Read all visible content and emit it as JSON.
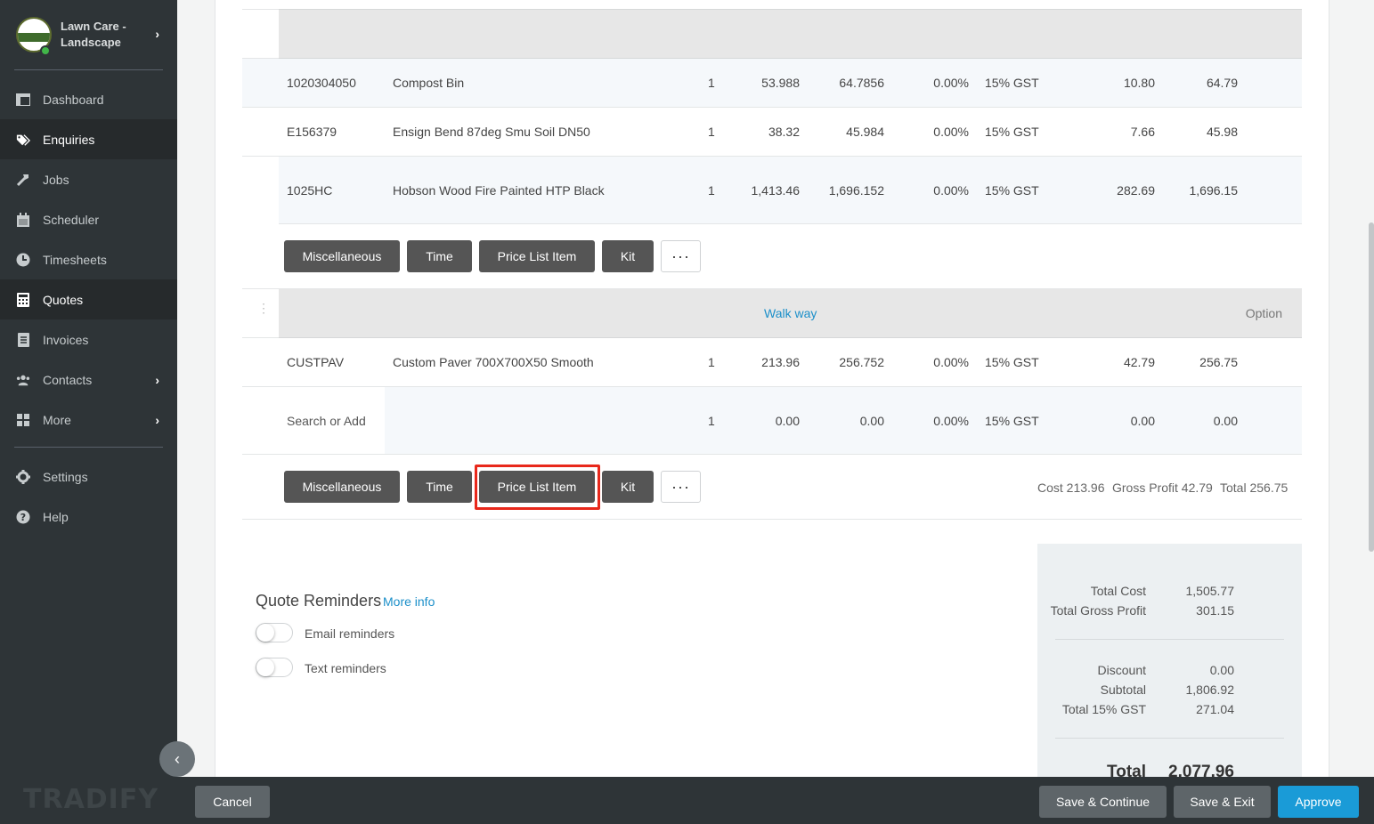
{
  "sidebar": {
    "company": "Lawn Care - Landscape",
    "logo_text": "LAWN CARE",
    "items": [
      {
        "label": "Dashboard",
        "icon": "dashboard-icon"
      },
      {
        "label": "Enquiries",
        "icon": "tags-icon"
      },
      {
        "label": "Jobs",
        "icon": "hammer-icon"
      },
      {
        "label": "Scheduler",
        "icon": "calendar-icon"
      },
      {
        "label": "Timesheets",
        "icon": "clock-icon"
      },
      {
        "label": "Quotes",
        "icon": "calculator-icon"
      },
      {
        "label": "Invoices",
        "icon": "document-icon"
      },
      {
        "label": "Contacts",
        "icon": "users-icon"
      },
      {
        "label": "More",
        "icon": "grid-icon"
      },
      {
        "label": "Settings",
        "icon": "gear-icon"
      },
      {
        "label": "Help",
        "icon": "help-icon"
      }
    ],
    "watermark": "TRADIFY"
  },
  "group1": {
    "rows": [
      {
        "code": "1020304050",
        "desc": "Compost Bin",
        "qty": "1",
        "cost": "53.988",
        "price": "64.7856",
        "discount": "0.00%",
        "tax": "15% GST",
        "profit": "10.80",
        "total": "64.79"
      },
      {
        "code": "E156379",
        "desc": "Ensign Bend 87deg Smu Soil DN50",
        "qty": "1",
        "cost": "38.32",
        "price": "45.984",
        "discount": "0.00%",
        "tax": "15% GST",
        "profit": "7.66",
        "total": "45.98"
      },
      {
        "code": "1025HC",
        "desc": "Hobson Wood Fire Painted HTP Black",
        "qty": "1",
        "cost": "1,413.46",
        "price": "1,696.152",
        "discount": "0.00%",
        "tax": "15% GST",
        "profit": "282.69",
        "total": "1,696.15"
      }
    ]
  },
  "buttons": {
    "miscellaneous": "Miscellaneous",
    "time": "Time",
    "price_list_item": "Price List Item",
    "kit": "Kit",
    "more": "···"
  },
  "group2": {
    "title": "Walk way",
    "option": "Option",
    "rows": [
      {
        "code": "CUSTPAV",
        "desc": "Custom Paver 700X700X50 Smooth",
        "qty": "1",
        "cost": "213.96",
        "price": "256.752",
        "discount": "0.00%",
        "tax": "15% GST",
        "profit": "42.79",
        "total": "256.75"
      },
      {
        "code": "Search or Add",
        "desc": "",
        "qty": "1",
        "cost": "0.00",
        "price": "0.00",
        "discount": "0.00%",
        "tax": "15% GST",
        "profit": "0.00",
        "total": "0.00"
      }
    ],
    "summary": {
      "cost": "Cost 213.96",
      "profit": "Gross Profit 42.79",
      "total": "Total 256.75"
    }
  },
  "reminders": {
    "title": "Quote Reminders",
    "more_info": "More info",
    "email": "Email reminders",
    "text": "Text reminders"
  },
  "totals": {
    "total_cost_label": "Total Cost",
    "total_cost": "1,505.77",
    "gross_profit_label": "Total Gross Profit",
    "gross_profit": "301.15",
    "discount_label": "Discount",
    "discount": "0.00",
    "subtotal_label": "Subtotal",
    "subtotal": "1,806.92",
    "gst_label": "Total 15% GST",
    "gst": "271.04",
    "total_label": "Total",
    "total": "2,077.96"
  },
  "footer": {
    "cancel": "Cancel",
    "save_continue": "Save & Continue",
    "save_exit": "Save & Exit",
    "approve": "Approve"
  }
}
